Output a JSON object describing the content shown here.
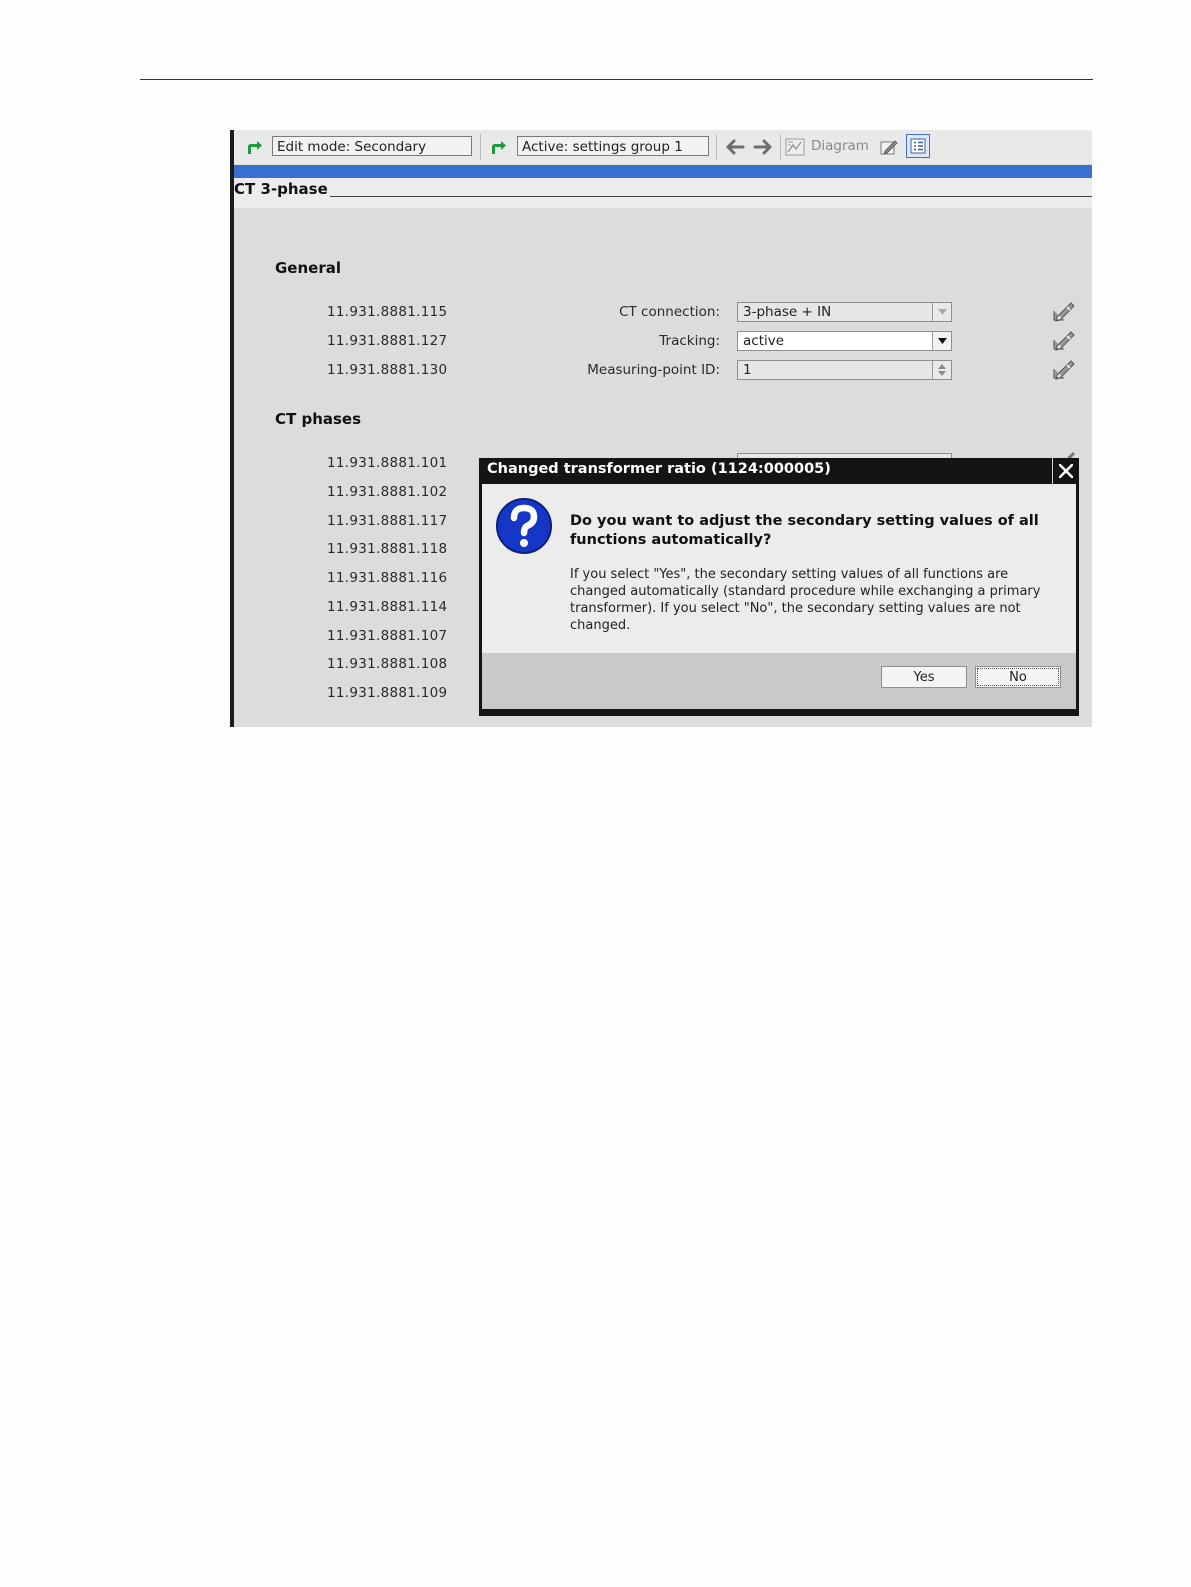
{
  "toolbar": {
    "edit_mode": "Edit mode:  Secondary",
    "active_group": "Active:  settings group 1",
    "diagram_label": "Diagram"
  },
  "section": {
    "title": "CT 3-phase"
  },
  "general": {
    "title": "General",
    "rows": [
      {
        "address": "11.931.8881.115",
        "label": "CT connection:",
        "value": "3-phase + IN",
        "control": "dropdown-disabled"
      },
      {
        "address": "11.931.8881.127",
        "label": "Tracking:",
        "value": "active",
        "control": "dropdown"
      },
      {
        "address": "11.931.8881.130",
        "label": "Measuring-point ID:",
        "value": "1",
        "control": "spinner"
      }
    ]
  },
  "ct_phases": {
    "title": "CT phases",
    "addresses": [
      "11.931.8881.101",
      "11.931.8881.102",
      "11.931.8881.117",
      "11.931.8881.118",
      "11.931.8881.116",
      "11.931.8881.114",
      "11.931.8881.107",
      "11.931.8881.108",
      "11.931.8881.109"
    ]
  },
  "dialog": {
    "title": "Changed transformer ratio (1124:000005)",
    "question": "Do you want to adjust the secondary setting values of all functions automatically?",
    "text": "If you select \"Yes\", the secondary setting values of all functions are changed automatically (standard procedure while exchanging a primary transformer). If you select \"No\", the secondary setting values are not changed.",
    "yes_label": "Yes",
    "no_label": "No"
  },
  "colors": {
    "accent_blue": "#3a6fd2",
    "dialog_frame": "#141414",
    "question_icon": "#1636c8",
    "arrow_green": "#1f9a3a"
  }
}
